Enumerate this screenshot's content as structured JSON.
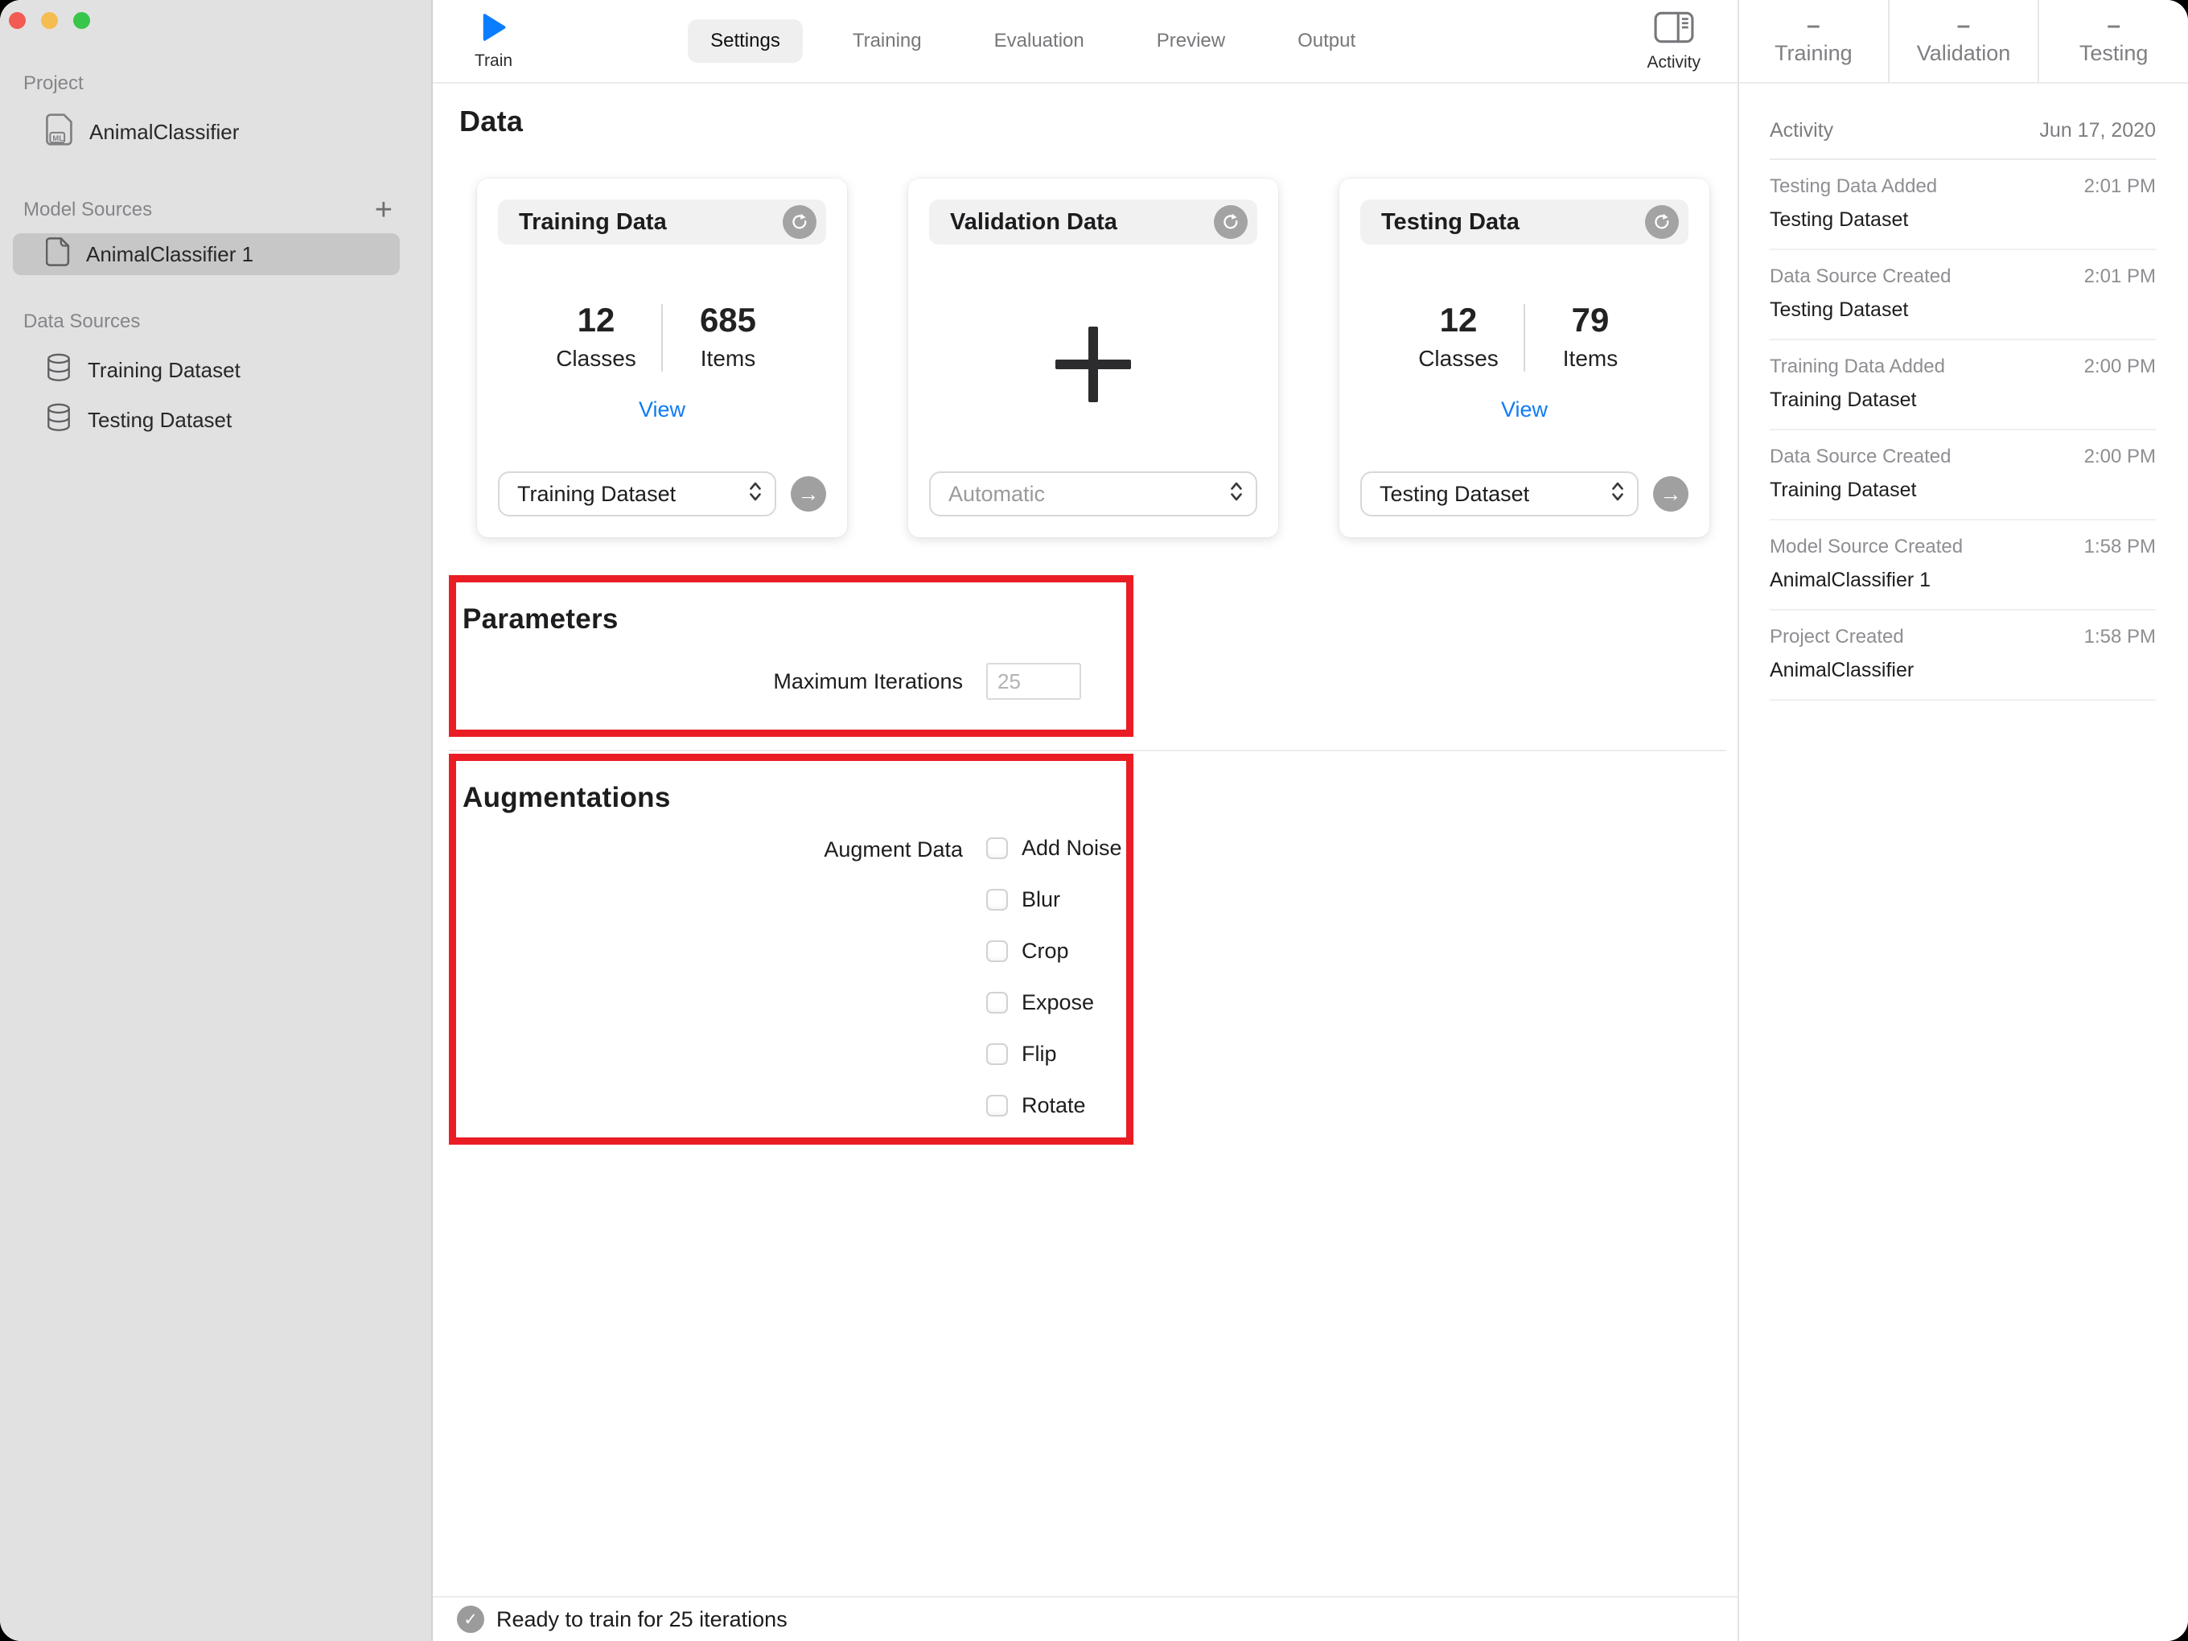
{
  "icons": {
    "plus": "+",
    "arrow_right": "→",
    "check": "✓",
    "ml_badge": "ML",
    "metric_placeholder": "–"
  },
  "colors": {
    "accent_blue": "#0f7bf5",
    "annotation_red": "#ea1d25",
    "traffic_red": "#f15b54",
    "traffic_yellow": "#f5bd4f",
    "traffic_green": "#37c649"
  },
  "sidebar": {
    "project_header": "Project",
    "project_item": "AnimalClassifier",
    "model_sources_header": "Model Sources",
    "model_item": "AnimalClassifier 1",
    "data_sources_header": "Data Sources",
    "data_items": [
      {
        "label": "Training Dataset"
      },
      {
        "label": "Testing Dataset"
      }
    ]
  },
  "toolbar": {
    "train_label": "Train",
    "tabs": [
      {
        "label": "Settings"
      },
      {
        "label": "Training"
      },
      {
        "label": "Evaluation"
      },
      {
        "label": "Preview"
      },
      {
        "label": "Output"
      }
    ],
    "activity_label": "Activity"
  },
  "stats_header": {
    "columns": [
      {
        "value": "–",
        "label": "Training"
      },
      {
        "value": "–",
        "label": "Validation"
      },
      {
        "value": "–",
        "label": "Testing"
      }
    ]
  },
  "main": {
    "title": "Data",
    "cards": [
      {
        "title": "Training Data",
        "classes_value": "12",
        "classes_label": "Classes",
        "items_value": "685",
        "items_label": "Items",
        "view_label": "View",
        "source": "Training Dataset"
      },
      {
        "title": "Validation Data",
        "source": "Automatic"
      },
      {
        "title": "Testing Data",
        "classes_value": "12",
        "classes_label": "Classes",
        "items_value": "79",
        "items_label": "Items",
        "view_label": "View",
        "source": "Testing Dataset"
      }
    ],
    "parameters": {
      "title": "Parameters",
      "label": "Maximum Iterations",
      "value": "25"
    },
    "augmentations": {
      "title": "Augmentations",
      "label": "Augment Data",
      "options": [
        "Add Noise",
        "Blur",
        "Crop",
        "Expose",
        "Flip",
        "Rotate"
      ]
    }
  },
  "activity_panel": {
    "title": "Activity",
    "date": "Jun 17, 2020",
    "entries": [
      {
        "title": "Testing Data Added",
        "time": "2:01 PM",
        "subtitle": "Testing Dataset"
      },
      {
        "title": "Data Source Created",
        "time": "2:01 PM",
        "subtitle": "Testing Dataset"
      },
      {
        "title": "Training Data Added",
        "time": "2:00 PM",
        "subtitle": "Training Dataset"
      },
      {
        "title": "Data Source Created",
        "time": "2:00 PM",
        "subtitle": "Training Dataset"
      },
      {
        "title": "Model Source Created",
        "time": "1:58 PM",
        "subtitle": "AnimalClassifier 1"
      },
      {
        "title": "Project Created",
        "time": "1:58 PM",
        "subtitle": "AnimalClassifier"
      }
    ]
  },
  "status_bar": {
    "message": "Ready to train for 25 iterations"
  }
}
